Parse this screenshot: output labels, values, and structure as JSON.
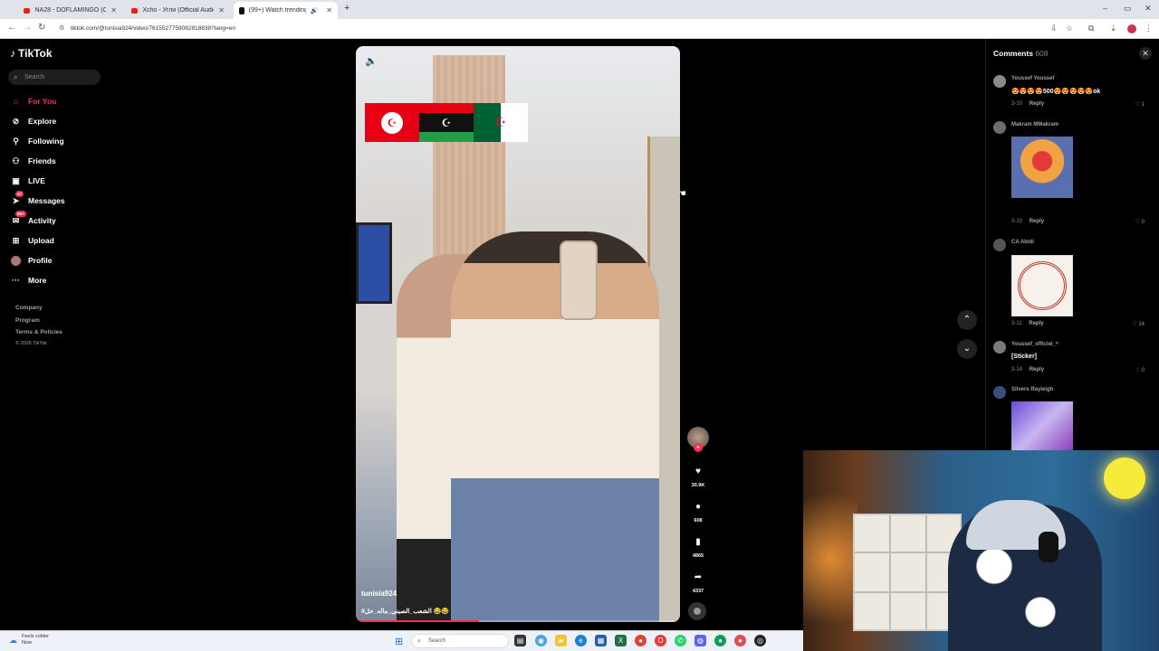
{
  "browser": {
    "tabs": [
      {
        "title": "NA28 - DOFLAMINGO (Officia"
      },
      {
        "title": "Xcho - Угли (Official Audio) - Y"
      },
      {
        "title": "(99+) Watch trending videos"
      }
    ],
    "new_tab": "+",
    "url": "tiktok.com/@tunisia924/video/7615527759082818838?lang=en"
  },
  "tiktok": {
    "logo": "TikTok",
    "search_placeholder": "Search",
    "nav": [
      {
        "label": "For You",
        "icon": "home-icon"
      },
      {
        "label": "Explore",
        "icon": "compass-icon"
      },
      {
        "label": "Following",
        "icon": "following-icon"
      },
      {
        "label": "Friends",
        "icon": "friends-icon"
      },
      {
        "label": "LIVE",
        "icon": "live-icon"
      },
      {
        "label": "Messages",
        "icon": "messages-icon",
        "badge": "47"
      },
      {
        "label": "Activity",
        "icon": "activity-icon",
        "badge": "99+"
      },
      {
        "label": "Upload",
        "icon": "upload-icon"
      },
      {
        "label": "Profile",
        "icon": "profile-icon"
      },
      {
        "label": "More",
        "icon": "more-icon"
      }
    ],
    "footer": [
      "Company",
      "Program",
      "Terms & Policies",
      "© 2026 TikTok"
    ]
  },
  "video": {
    "author": "tunisia924",
    "caption": "#الشعب_الصيني_ماله_حل 😂😂",
    "progress": 0.38,
    "actions": {
      "likes": "30.9K",
      "comments": "608",
      "saves": "4865",
      "shares": "4337"
    }
  },
  "comments_panel": {
    "title": "Comments",
    "count": "608",
    "items": [
      {
        "user": "Youssef Youssef",
        "text": "😍😍😍😍500😍😍😍😍😍ok",
        "date": "3-10",
        "reply": "Reply",
        "likes": "1"
      },
      {
        "user": "Makram MMakram",
        "sticker": "rose-heart-sticker",
        "date": "3-10",
        "reply": "Reply",
        "likes": "0"
      },
      {
        "user": "CA Abidi",
        "sticker": "arabic-stamp-sticker",
        "date": "3-11",
        "reply": "Reply",
        "likes": "14"
      },
      {
        "user": "Youssef_officiel_ᵗⁿ",
        "text": "[Sticker]",
        "date": "3-14",
        "reply": "Reply",
        "likes": "0"
      },
      {
        "user": "Silvers Rayleigh",
        "sticker": "goat-sticker",
        "date": "",
        "reply": "",
        "likes": ""
      }
    ]
  },
  "taskbar": {
    "weather_title": "Feels colder",
    "weather_sub": "Now",
    "search_placeholder": "Search"
  },
  "colors": {
    "accent": "#fe2c55",
    "background": "#000000"
  }
}
